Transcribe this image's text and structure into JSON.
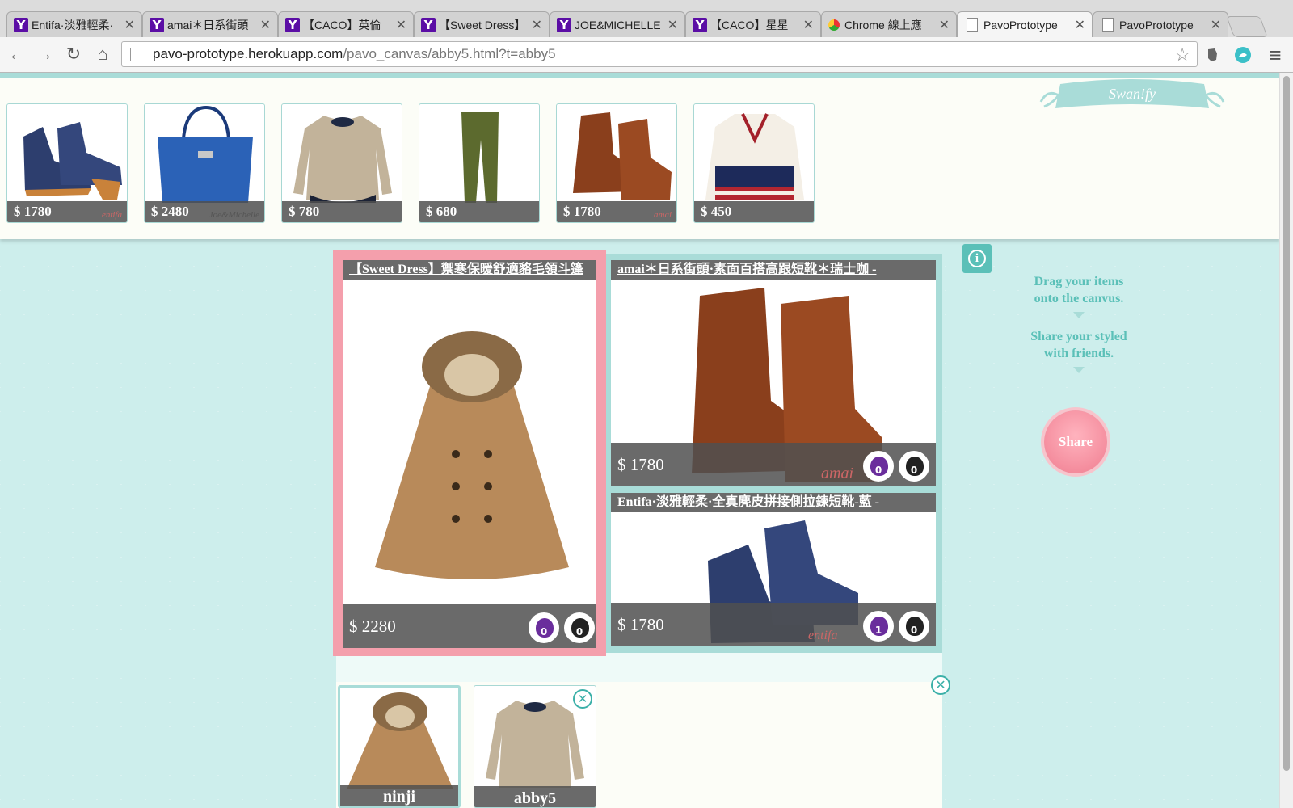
{
  "browser": {
    "tabs": [
      {
        "title": "Entifa·淡雅輕柔·",
        "icon": "yahoo"
      },
      {
        "title": "amai＊日系街頭",
        "icon": "yahoo"
      },
      {
        "title": "【CACO】英倫",
        "icon": "yahoo"
      },
      {
        "title": "【Sweet Dress】",
        "icon": "yahoo"
      },
      {
        "title": "JOE&MICHELLE",
        "icon": "yahoo"
      },
      {
        "title": "【CACO】星星",
        "icon": "yahoo"
      },
      {
        "title": "Chrome 線上應",
        "icon": "chrome"
      },
      {
        "title": "PavoPrototype",
        "icon": "doc"
      },
      {
        "title": "PavoPrototype",
        "icon": "doc"
      }
    ],
    "tab_close": "✕",
    "yahoo_glyph": "Y",
    "url_host": "pavo-prototype.herokuapp.com",
    "url_path": "/pavo_canvas/abby5.html?t=abby5",
    "icons": {
      "back": "←",
      "forward": "→",
      "reload": "↻",
      "home": "⌂",
      "star": "☆",
      "menu": "≡"
    }
  },
  "logo": {
    "text": "Swan!fy"
  },
  "tray": [
    {
      "price": "$ 1780",
      "brand": "entifa",
      "kind": "blue-boots"
    },
    {
      "price": "$ 2480",
      "brand": "Joe&Michelle",
      "kind": "blue-bag"
    },
    {
      "price": "$ 780",
      "brand": "",
      "kind": "beige-top"
    },
    {
      "price": "$ 680",
      "brand": "",
      "kind": "green-pants"
    },
    {
      "price": "$ 1780",
      "brand": "amai",
      "kind": "brown-boots"
    },
    {
      "price": "$ 450",
      "brand": "",
      "kind": "flag-cardigan"
    }
  ],
  "canvas": {
    "items": [
      {
        "title": "【Sweet Dress】禦寒保暖舒適貉毛領斗篷",
        "price": "$ 2280",
        "up": "0",
        "down": "0",
        "brand": ""
      },
      {
        "title": "amai＊日系街頭·素面百搭高跟短靴＊瑞士咖 -",
        "price": "$ 1780",
        "up": "0",
        "down": "0",
        "brand": "amai"
      },
      {
        "title": "Entifa·淡雅輕柔·全真麂皮拼接側拉鍊短靴-藍 -",
        "price": "$ 1780",
        "up": "1",
        "down": "0",
        "brand": "entifa"
      }
    ]
  },
  "sidebar": {
    "info_glyph": "i",
    "step1": "Drag your items onto the canvus.",
    "step2": "Share your styled with friends.",
    "share_label": "Share"
  },
  "collection": {
    "close_glyph": "✕",
    "looks": [
      {
        "name": "ninji",
        "current": true
      },
      {
        "name": "abby5",
        "current": false
      }
    ],
    "delete_glyph": "✕"
  },
  "colors": {
    "accent_teal": "#5bc0b8",
    "frame_teal": "#a9dcd8",
    "share_pink": "#f07d90",
    "selected_pink": "#f49fac"
  }
}
